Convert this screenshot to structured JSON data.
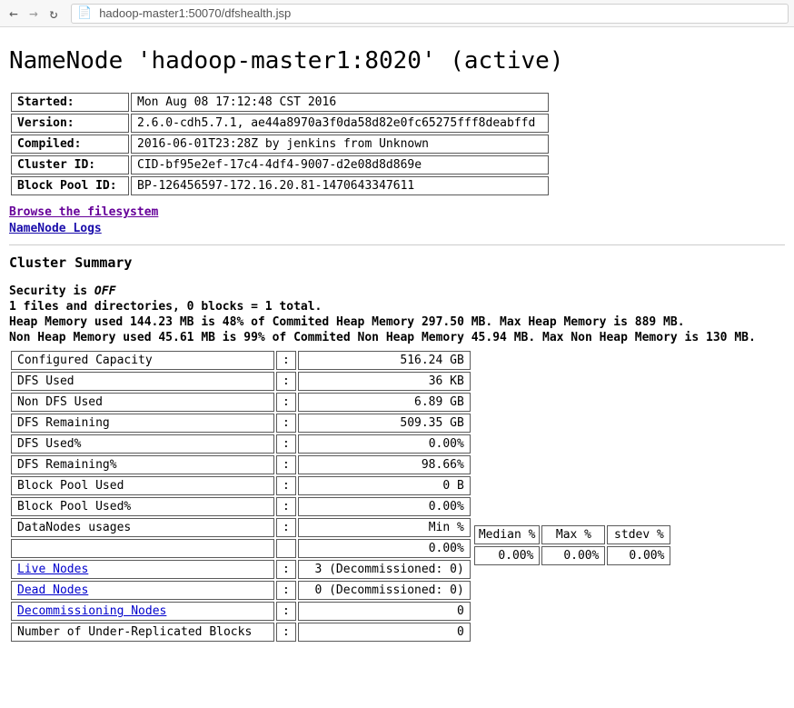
{
  "chrome": {
    "url": "hadoop-master1:50070/dfshealth.jsp"
  },
  "page_title": "NameNode 'hadoop-master1:8020' (active)",
  "meta": [
    {
      "k": "Started:",
      "v": "Mon Aug 08 17:12:48 CST 2016"
    },
    {
      "k": "Version:",
      "v": "2.6.0-cdh5.7.1, ae44a8970a3f0da58d82e0fc65275fff8deabffd"
    },
    {
      "k": "Compiled:",
      "v": "2016-06-01T23:28Z by jenkins from Unknown"
    },
    {
      "k": "Cluster ID:",
      "v": "CID-bf95e2ef-17c4-4df4-9007-d2e08d8d869e"
    },
    {
      "k": "Block Pool ID:",
      "v": "BP-126456597-172.16.20.81-1470643347611"
    }
  ],
  "links": {
    "browse_fs": "Browse the filesystem",
    "namenode_logs": "NameNode Logs"
  },
  "summary_heading": "Cluster Summary",
  "security_line_pre": "Security is ",
  "security_state": "OFF",
  "files_line": "1 files and directories, 0 blocks = 1 total.",
  "heap_line": "Heap Memory used 144.23 MB is 48% of Commited Heap Memory 297.50 MB. Max Heap Memory is 889 MB.",
  "nonheap_line": "Non Heap Memory used 45.61 MB is 99% of Commited Non Heap Memory 45.94 MB. Max Non Heap Memory is 130 MB.",
  "summary": {
    "configured_capacity": {
      "label": "Configured Capacity",
      "val": "516.24 GB"
    },
    "dfs_used": {
      "label": "DFS Used",
      "val": "36 KB"
    },
    "non_dfs_used": {
      "label": "Non DFS Used",
      "val": "6.89 GB"
    },
    "dfs_remaining": {
      "label": "DFS Remaining",
      "val": "509.35 GB"
    },
    "dfs_used_pct": {
      "label": "DFS Used%",
      "val": "0.00%"
    },
    "dfs_remaining_pct": {
      "label": "DFS Remaining%",
      "val": "98.66%"
    },
    "block_pool_used": {
      "label": "Block Pool Used",
      "val": "0 B"
    },
    "block_pool_used_pct": {
      "label": "Block Pool Used%",
      "val": "0.00%"
    },
    "datanodes_usages": {
      "label": "DataNodes usages",
      "val": "Min %"
    },
    "usage_headers": {
      "median": "Median %",
      "max": "Max %",
      "stdev": "stdev %"
    },
    "usage_values": {
      "min": "0.00%",
      "median": "0.00%",
      "max": "0.00%",
      "stdev": "0.00%"
    },
    "live_nodes": {
      "label": "Live Nodes",
      "val": "3 (Decommissioned: 0)"
    },
    "dead_nodes": {
      "label": "Dead Nodes",
      "val": "0 (Decommissioned: 0)"
    },
    "decommissioning": {
      "label": "Decommissioning Nodes",
      "val": "0"
    },
    "under_replicated": {
      "label": "Number of Under-Replicated Blocks",
      "val": "0"
    }
  }
}
